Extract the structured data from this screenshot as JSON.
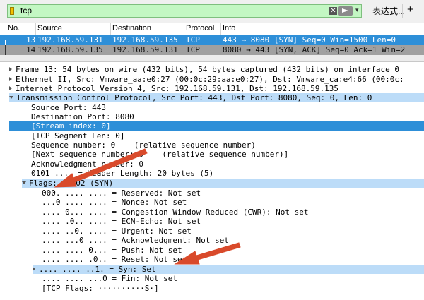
{
  "filter": {
    "value": "tcp",
    "clear_glyph": "✕",
    "dropdown_glyph": "▾",
    "expression_label": "表达式...",
    "add_label": "+"
  },
  "columns": [
    "No.",
    "Source",
    "Destination",
    "Protocol",
    "Info"
  ],
  "packets": [
    {
      "no": "13",
      "source": "192.168.59.131",
      "destination": "192.168.59.135",
      "protocol": "TCP",
      "info": "443 → 8080 [SYN] Seq=0 Win=1500 Len=0"
    },
    {
      "no": "14",
      "source": "192.168.59.135",
      "destination": "192.168.59.131",
      "protocol": "TCP",
      "info": "8080 → 443 [SYN, ACK] Seq=0 Ack=1 Win=2"
    }
  ],
  "details": {
    "frame": "Frame 13: 54 bytes on wire (432 bits), 54 bytes captured (432 bits) on interface 0",
    "ethernet": "Ethernet II, Src: Vmware_aa:e0:27 (00:0c:29:aa:e0:27), Dst: Vmware_ca:e4:66 (00:0c:",
    "ip": "Internet Protocol Version 4, Src: 192.168.59.131, Dst: 192.168.59.135",
    "tcp": "Transmission Control Protocol, Src Port: 443, Dst Port: 8080, Seq: 0, Len: 0",
    "tcp_fields": [
      "Source Port: 443",
      "Destination Port: 8080",
      "[Stream index: 0]",
      "[TCP Segment Len: 0]",
      "Sequence number: 0    (relative sequence number)",
      "[Next sequence number: 0    (relative sequence number)]",
      "Acknowledgment number: 0",
      "0101 .... = Header Length: 20 bytes (5)"
    ],
    "flags": "Flags: 0x002 (SYN)",
    "flag_bits": [
      "000. .... .... = Reserved: Not set",
      "...0 .... .... = Nonce: Not set",
      ".... 0... .... = Congestion Window Reduced (CWR): Not set",
      ".... .0.. .... = ECN-Echo: Not set",
      ".... ..0. .... = Urgent: Not set",
      ".... ...0 .... = Acknowledgment: Not set",
      ".... .... 0... = Push: Not set",
      ".... .... .0.. = Reset: Not set",
      ".... .... ..1. = Syn: Set",
      ".... .... ...0 = Fin: Not set"
    ],
    "tcp_flags_str": "[TCP Flags: ··········S·]"
  },
  "colors": {
    "filter_bg": "#c3f7c3",
    "selected_row": "#2e8fd8",
    "other_row": "#a0a0a0",
    "tree_highlight": "#bcdcf8",
    "annotation_arrow": "#d94a2b"
  }
}
